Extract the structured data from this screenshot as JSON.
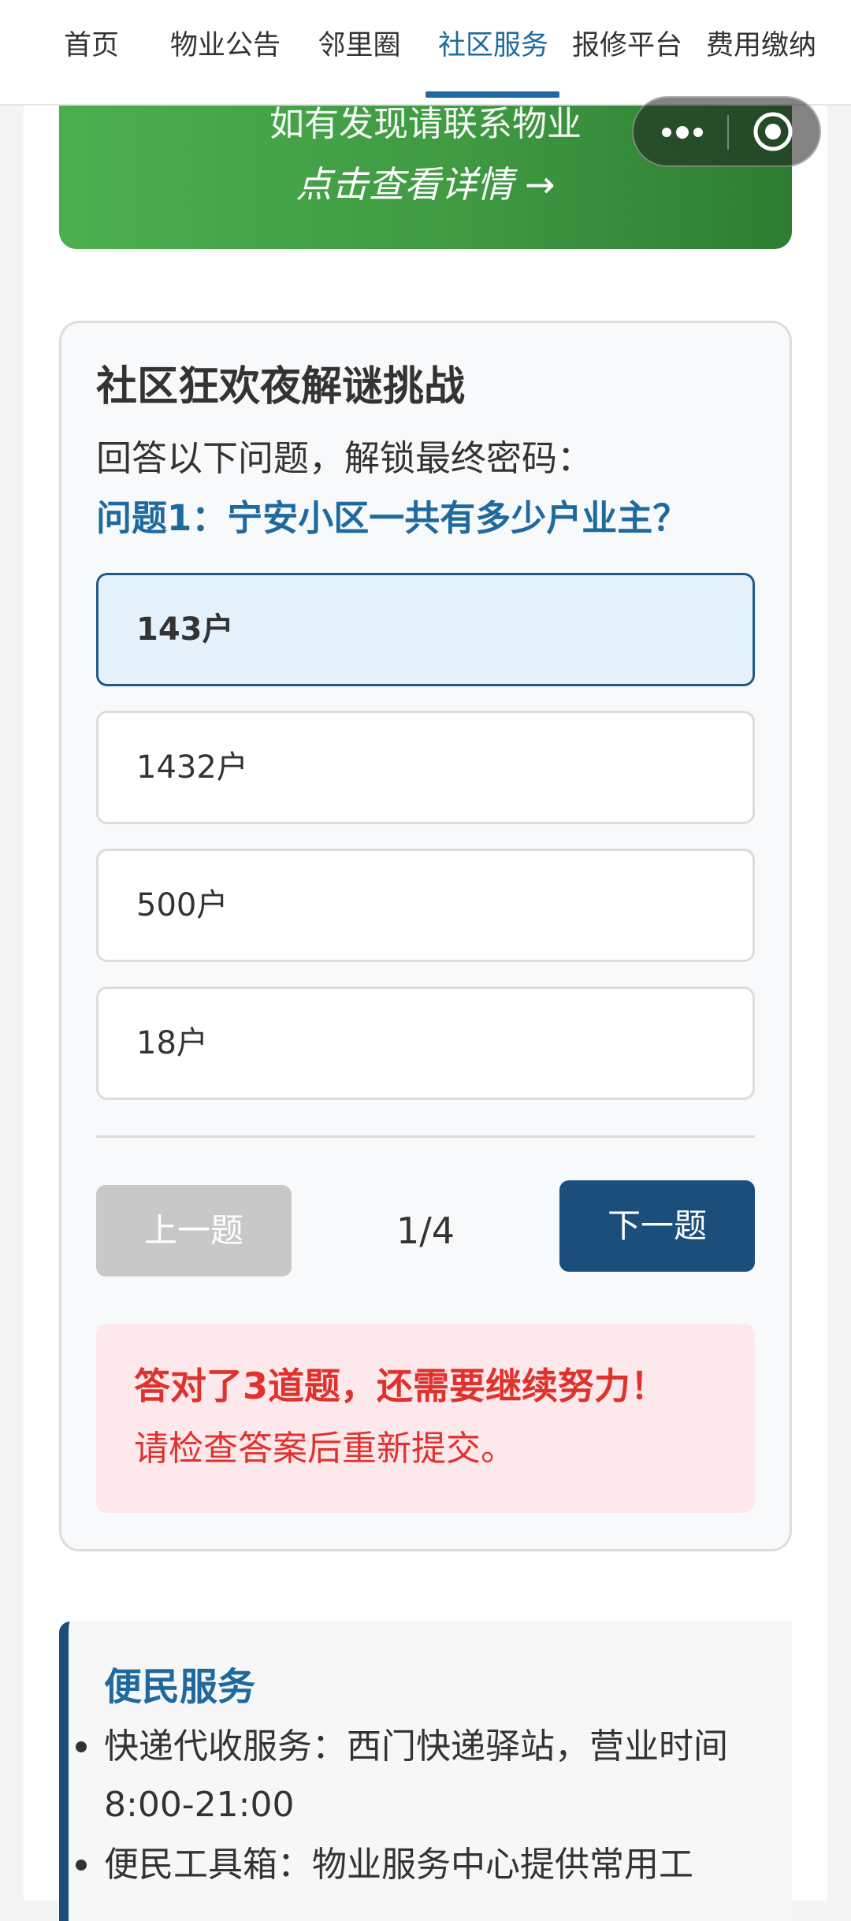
{
  "nav": {
    "tabs": [
      {
        "label": "首页",
        "active": false
      },
      {
        "label": "物业公告",
        "active": false
      },
      {
        "label": "邻里圈",
        "active": false
      },
      {
        "label": "社区服务",
        "active": true
      },
      {
        "label": "报修平台",
        "active": false
      },
      {
        "label": "费用缴纳",
        "active": false
      }
    ]
  },
  "banner": {
    "line1": "如有发现请联系物业",
    "line2": "点击查看详情 →"
  },
  "capsule": {
    "more_icon": "more-dots-icon",
    "close_icon": "target-close-icon"
  },
  "quiz": {
    "title": "社区狂欢夜解谜挑战",
    "description": "回答以下问题，解锁最终密码：",
    "question": "问题1：宁安小区一共有多少户业主？",
    "options": [
      {
        "label": "143户",
        "selected": true
      },
      {
        "label": "1432户",
        "selected": false
      },
      {
        "label": "500户",
        "selected": false
      },
      {
        "label": "18户",
        "selected": false
      }
    ],
    "prev_label": "上一题",
    "progress": "1/4",
    "next_label": "下一题",
    "result_line1": "答对了3道题，还需要继续努力！",
    "result_line2": "请检查答案后重新提交。"
  },
  "services": {
    "title": "便民服务",
    "items": [
      "快递代收服务：西门快递驿站，营业时间8:00-21:00",
      "便民工具箱：物业服务中心提供常用工"
    ]
  },
  "colors": {
    "accent": "#1e6a9e",
    "primary_button": "#1c4e7c",
    "banner_green": "#4cae4f",
    "error_red": "#e0322d",
    "error_bg": "#fde8eb",
    "selected_bg": "#e5f2fc"
  }
}
